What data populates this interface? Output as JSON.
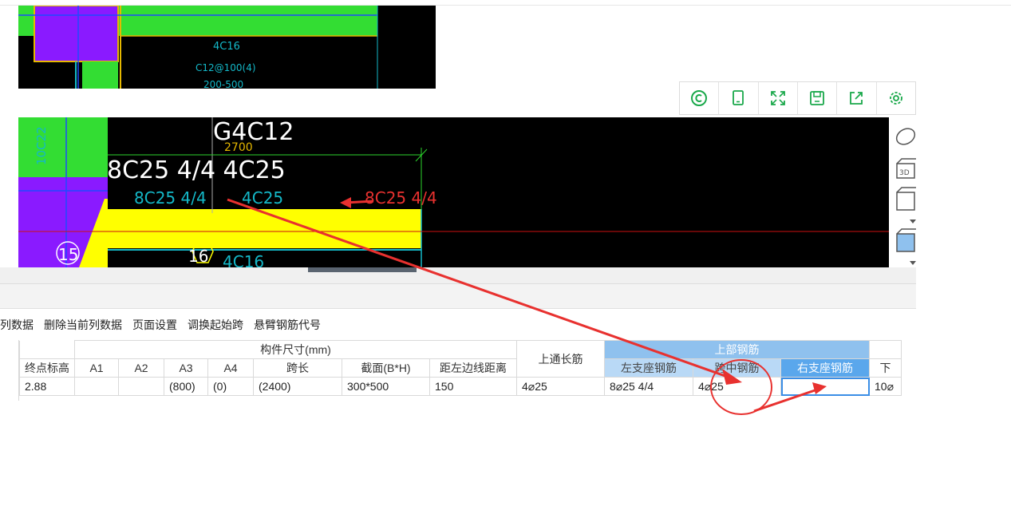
{
  "cad_top": {
    "labels": [
      "4C16",
      "C12@100(4)",
      "200-500"
    ]
  },
  "cad_main": {
    "beam_mark": "G4C12",
    "dim_2700": "2700",
    "white_note": "8C25 4/4 4C25",
    "cyan_left": "8C25 4/4",
    "cyan_mid": "4C25",
    "red_right": "8C25 4/4",
    "col_label": "10C22",
    "bottom_label": "4C16",
    "axis_15": "15",
    "axis_16": "16"
  },
  "toolbar": {
    "icons": [
      "copyright-icon",
      "tablet-icon",
      "fullscreen-icon",
      "save-icon",
      "share-icon",
      "gear-icon"
    ]
  },
  "side_tools": [
    "ellipse-icon",
    "3d-box-icon",
    "box-outline-icon",
    "box-solid-icon"
  ],
  "side_tool_labels": {
    "box3d": "3D"
  },
  "menu": {
    "items": [
      "列数据",
      "删除当前列数据",
      "页面设置",
      "调换起始跨",
      "悬臂钢筋代号"
    ]
  },
  "grid": {
    "group_headers": {
      "dimensions": "构件尺寸(mm)",
      "top_rebar": "上部钢筋"
    },
    "headers": {
      "end_elev": "终点标高",
      "a1": "A1",
      "a2": "A2",
      "a3": "A3",
      "a4": "A4",
      "span": "跨长",
      "section": "截面(B*H)",
      "dist_edge": "距左边线距离",
      "top_continuous": "上通长筋",
      "left_support": "左支座钢筋",
      "mid_span": "跨中钢筋",
      "right_support": "右支座钢筋",
      "next": "下"
    },
    "row": {
      "end_elev": "2.88",
      "a1": "",
      "a2": "",
      "a3": "(800)",
      "a4": "(0)",
      "span": "(2400)",
      "section": "300*500",
      "dist_edge": "150",
      "top_continuous": "4⌀25",
      "left_support": "8⌀25 4/4",
      "mid_span": "4⌀25",
      "right_support": "",
      "next": "10⌀"
    }
  },
  "colors": {
    "cad_bg": "#000000",
    "green_fill": "#33dd33",
    "purple_fill": "#8a1aff",
    "yellow_fill": "#ffff00",
    "cyan_line": "#14b8c8",
    "annotation_red": "#e8312f",
    "header_blue": "#8fc1ee",
    "selected_blue": "#5aa7ec",
    "toolbar_green": "#19a84a"
  }
}
